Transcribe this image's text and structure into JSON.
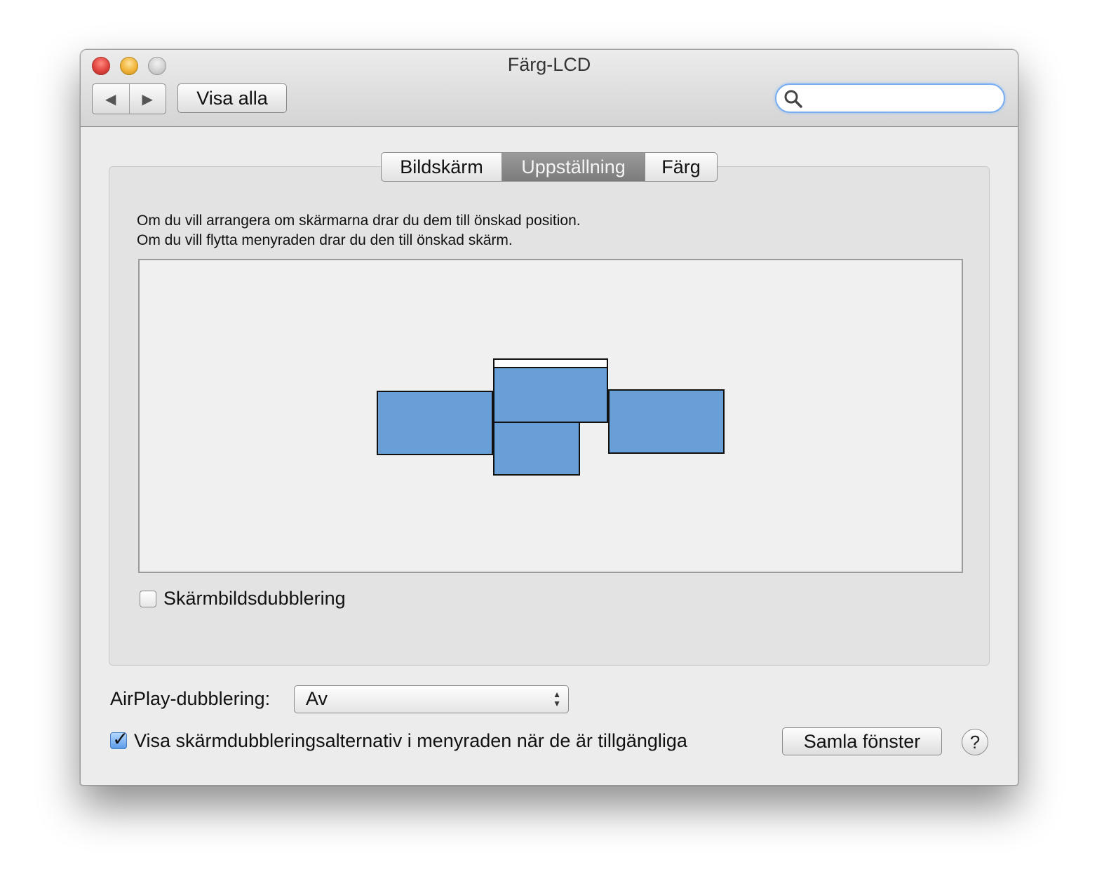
{
  "window": {
    "title": "Färg-LCD"
  },
  "toolbar": {
    "back_icon": "◀",
    "forward_icon": "▶",
    "show_all_label": "Visa alla",
    "search_placeholder": "",
    "search_value": ""
  },
  "tabs": [
    {
      "label": "Bildskärm",
      "active": false
    },
    {
      "label": "Uppställning",
      "active": true
    },
    {
      "label": "Färg",
      "active": false
    }
  ],
  "arrangement": {
    "instruction_line1": "Om du vill arrangera om skärmarna drar du dem till önskad position.",
    "instruction_line2": "Om du vill flytta menyraden drar du den till önskad skärm.",
    "display_color": "#679fd6",
    "displays": [
      {
        "name": "display-left",
        "has_menubar": false
      },
      {
        "name": "display-main",
        "has_menubar": true
      },
      {
        "name": "display-right",
        "has_menubar": false
      },
      {
        "name": "display-bottom",
        "has_menubar": false
      }
    ]
  },
  "mirroring": {
    "label": "Skärmbildsdubblering",
    "checked": false
  },
  "airplay": {
    "label": "AirPlay-dubblering:",
    "selected": "Av"
  },
  "menubar_option": {
    "label": "Visa skärmdubbleringsalternativ i menyraden när de är tillgängliga",
    "checked": true
  },
  "gather_button": {
    "label": "Samla fönster"
  },
  "help": {
    "label": "?"
  }
}
